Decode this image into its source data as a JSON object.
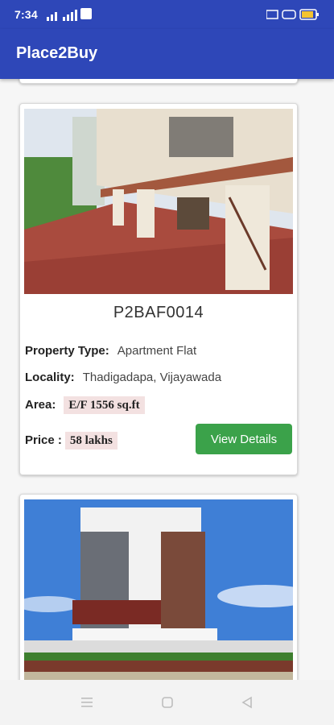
{
  "status_bar": {
    "time": "7:34",
    "icons": [
      "signal-icon",
      "wifi-icon",
      "phone-icon",
      "network-icon",
      "vibrate-icon",
      "battery-icon"
    ]
  },
  "app_bar": {
    "title": "Place2Buy"
  },
  "listings": [
    {
      "code": "P2BAF0014",
      "property_type_label": "Property Type:",
      "property_type": "Apartment Flat",
      "locality_label": "Locality:",
      "locality": "Thadigadapa, Vijayawada",
      "area_label": "Area:",
      "area": "E/F 1556 sq.ft",
      "price_label": "Price :",
      "price": "58 lakhs",
      "button_label": "View Details"
    }
  ],
  "nav_bar": {
    "icons": [
      "menu-icon",
      "home-icon",
      "back-icon"
    ]
  },
  "colors": {
    "primary": "#2e47b8",
    "button": "#3ba24a",
    "chip": "#f3e1e1"
  }
}
